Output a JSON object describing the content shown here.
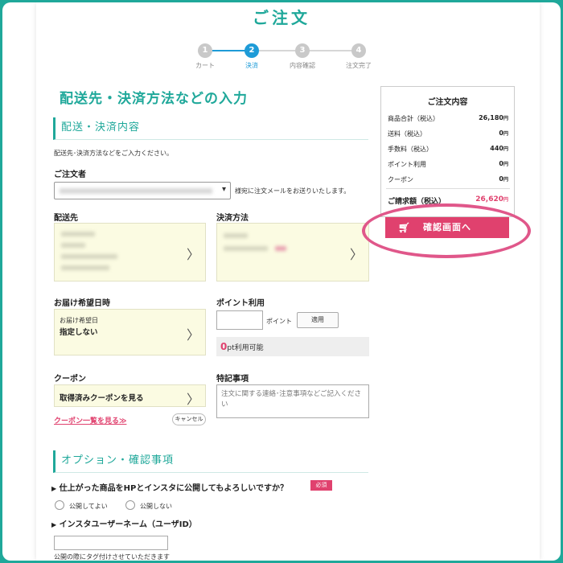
{
  "page_title": "ご注文",
  "steps": [
    {
      "num": "1",
      "label": "カート"
    },
    {
      "num": "2",
      "label": "決済"
    },
    {
      "num": "3",
      "label": "内容確認"
    },
    {
      "num": "4",
      "label": "注文完了"
    }
  ],
  "main_heading": "配送先・決済方法などの入力",
  "delivery_section": {
    "title": "配送・決済内容",
    "instruction": "配送先･決済方法などをご入力ください。",
    "orderer_label": "ご注文者",
    "orderer_note": "様宛に注文メールをお送りいたします。",
    "shipping_label": "配送先",
    "payment_label": "決済方法",
    "delivery_time_label": "お届け希望日時",
    "delivery_date_caption": "お届け希望日",
    "delivery_date_value": "指定しない",
    "points_label": "ポイント利用",
    "points_unit": "ポイント",
    "apply_button": "適用",
    "points_available_value": "0",
    "points_available_text": "pt利用可能",
    "coupon_label": "クーポン",
    "coupon_view_owned": "取得済みクーポンを見る",
    "coupon_list_link": "クーポン一覧を見る≫",
    "cancel_button": "キャンセル",
    "notes_label": "特記事項",
    "notes_placeholder": "注文に関する連絡･注意事項などご記入ください"
  },
  "options_section": {
    "title": "オプション・確認事項",
    "question": "仕上がった商品をHPとインスタに公開してもよろしいですか？",
    "required_badge": "必須",
    "option_yes": "公開してよい",
    "option_no": "公開しない",
    "insta_label": "インスタユーザーネーム（ユーザID）",
    "insta_note": "公開の際にタグ付けさせていただきます"
  },
  "summary": {
    "title": "ご注文内容",
    "rows": [
      {
        "label": "商品合計（税込）",
        "value": "26,180",
        "unit": "円"
      },
      {
        "label": "送料（税込）",
        "value": "0",
        "unit": "円"
      },
      {
        "label": "手数料（税込）",
        "value": "440",
        "unit": "円"
      },
      {
        "label": "ポイント利用",
        "value": "0",
        "unit": "円"
      },
      {
        "label": "クーポン",
        "value": "0",
        "unit": "円"
      }
    ],
    "total_label": "ご請求額（税込）",
    "total_value": "26,620",
    "total_unit": "円",
    "confirm_button": "確認画面へ"
  },
  "colors": {
    "accent": "#1fa89a",
    "step_active": "#1e9bd7",
    "pink": "#e0416e",
    "card_bg": "#fbfbe2"
  },
  "icons": [
    "cart-icon",
    "chevron-right-icon",
    "triangle-right-icon",
    "caret-down-icon"
  ]
}
